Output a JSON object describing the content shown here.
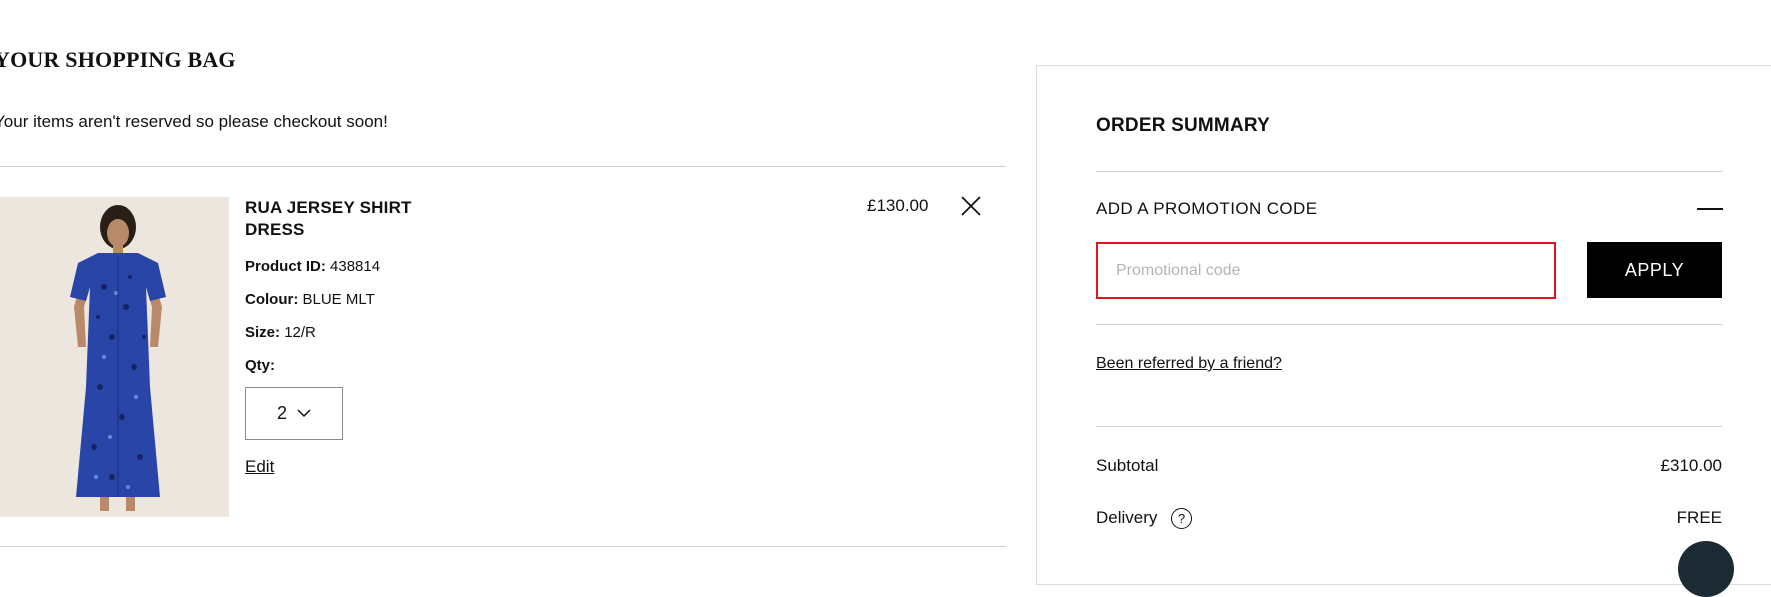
{
  "bag": {
    "title": "YOUR SHOPPING BAG",
    "notice": "Your items aren't reserved so please checkout soon!"
  },
  "item": {
    "name": "RUA JERSEY SHIRT DRESS",
    "product_id_label": "Product ID:",
    "product_id": "438814",
    "colour_label": "Colour:",
    "colour": "BLUE MLT",
    "size_label": "Size:",
    "size": "12/R",
    "qty_label": "Qty:",
    "qty": "2",
    "edit_label": "Edit",
    "price": "£130.00",
    "image_alt": "Model wearing a blue floral shirt dress"
  },
  "summary": {
    "title": "ORDER SUMMARY",
    "promo_header": "ADD A PROMOTION CODE",
    "promo_placeholder": "Promotional code",
    "apply_label": "APPLY",
    "referral_label": "Been referred by a friend?",
    "subtotal_label": "Subtotal",
    "subtotal_value": "£310.00",
    "delivery_label": "Delivery",
    "delivery_value": "FREE",
    "help_glyph": "?"
  },
  "icons": {
    "close": "close-icon",
    "chevron": "chevron-down-icon",
    "collapse": "minus-icon",
    "help": "question-circle-icon"
  },
  "colors": {
    "accent_error": "#e0141e",
    "button_bg": "#000000",
    "dress": "#2a45a8"
  }
}
